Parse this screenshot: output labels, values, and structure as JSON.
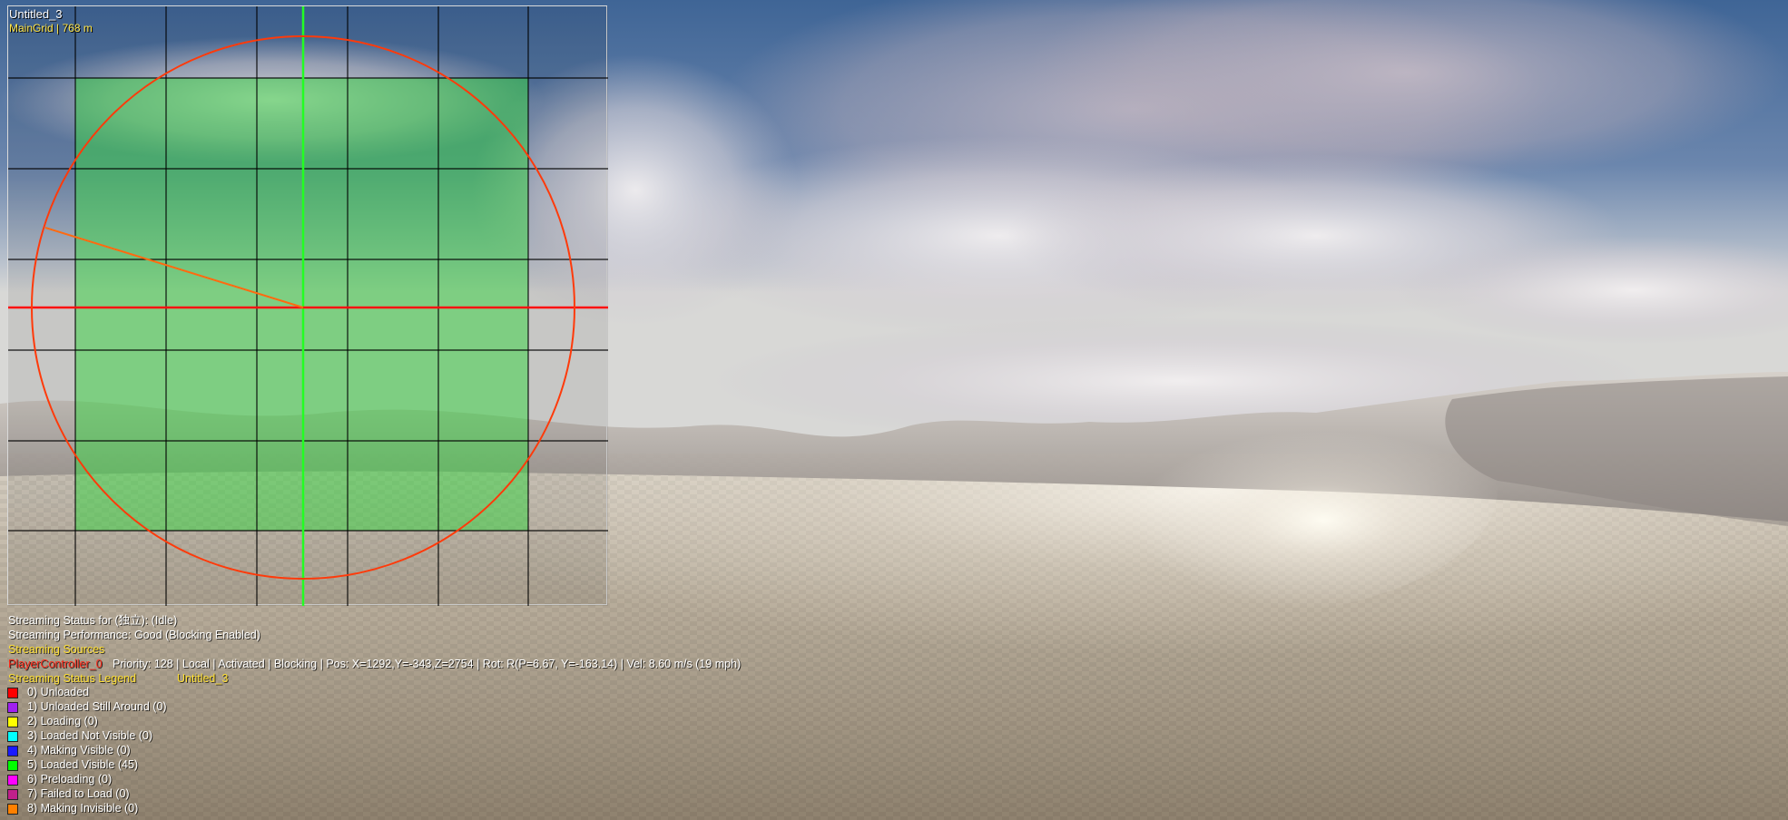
{
  "minimap": {
    "level_name": "Untitled_3",
    "grid_label": "MainGrid | 768 m"
  },
  "status": {
    "streaming_status": "Streaming Status for (独立): (Idle)",
    "streaming_performance": "Streaming Performance: Good (Blocking Enabled)",
    "sources_header": "Streaming Sources",
    "source_name": "PlayerController_0",
    "source_details": "Priority: 128 | Local | Activated | Blocking | Pos: X=1292,Y=-343,Z=2754 | Rot: R(P=6.67, Y=-163.14) | Vel: 8.60 m/s (19 mph)",
    "legend_header": "Streaming Status Legend",
    "legend_level": "Untitled_3"
  },
  "legend": [
    {
      "label": "0) Unloaded",
      "color": "#ff0000"
    },
    {
      "label": "1) Unloaded Still Around (0)",
      "color": "#a020f0"
    },
    {
      "label": "2) Loading (0)",
      "color": "#ffff00"
    },
    {
      "label": "3) Loaded Not Visible (0)",
      "color": "#00ffff"
    },
    {
      "label": "4) Making Visible (0)",
      "color": "#1a1aff"
    },
    {
      "label": "5) Loaded Visible (45)",
      "color": "#00ff00"
    },
    {
      "label": "6) Preloading (0)",
      "color": "#ff00ff"
    },
    {
      "label": "7) Failed to Load (0)",
      "color": "#c0208a"
    },
    {
      "label": "8) Making Invisible (0)",
      "color": "#ff8000"
    }
  ]
}
